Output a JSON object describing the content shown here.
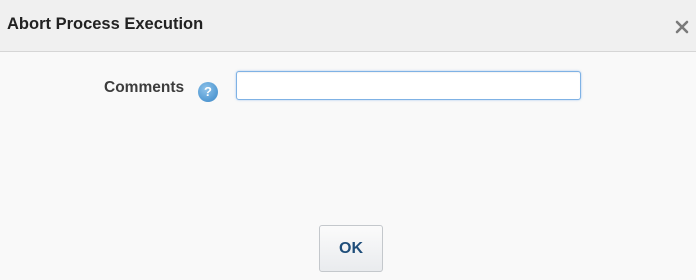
{
  "dialog": {
    "title": "Abort Process Execution",
    "close_icon": "close-icon"
  },
  "form": {
    "comments_label": "Comments",
    "help_icon": "help-icon",
    "help_glyph": "?",
    "comments_value": "",
    "comments_placeholder": ""
  },
  "footer": {
    "ok_label": "OK"
  },
  "colors": {
    "title_bar_bg": "#f0f0f0",
    "body_bg": "#f9f9f9",
    "help_icon_blue": "#5a9fd6",
    "input_focus_border": "#7fb2e5",
    "ok_text": "#1f4e7a"
  }
}
